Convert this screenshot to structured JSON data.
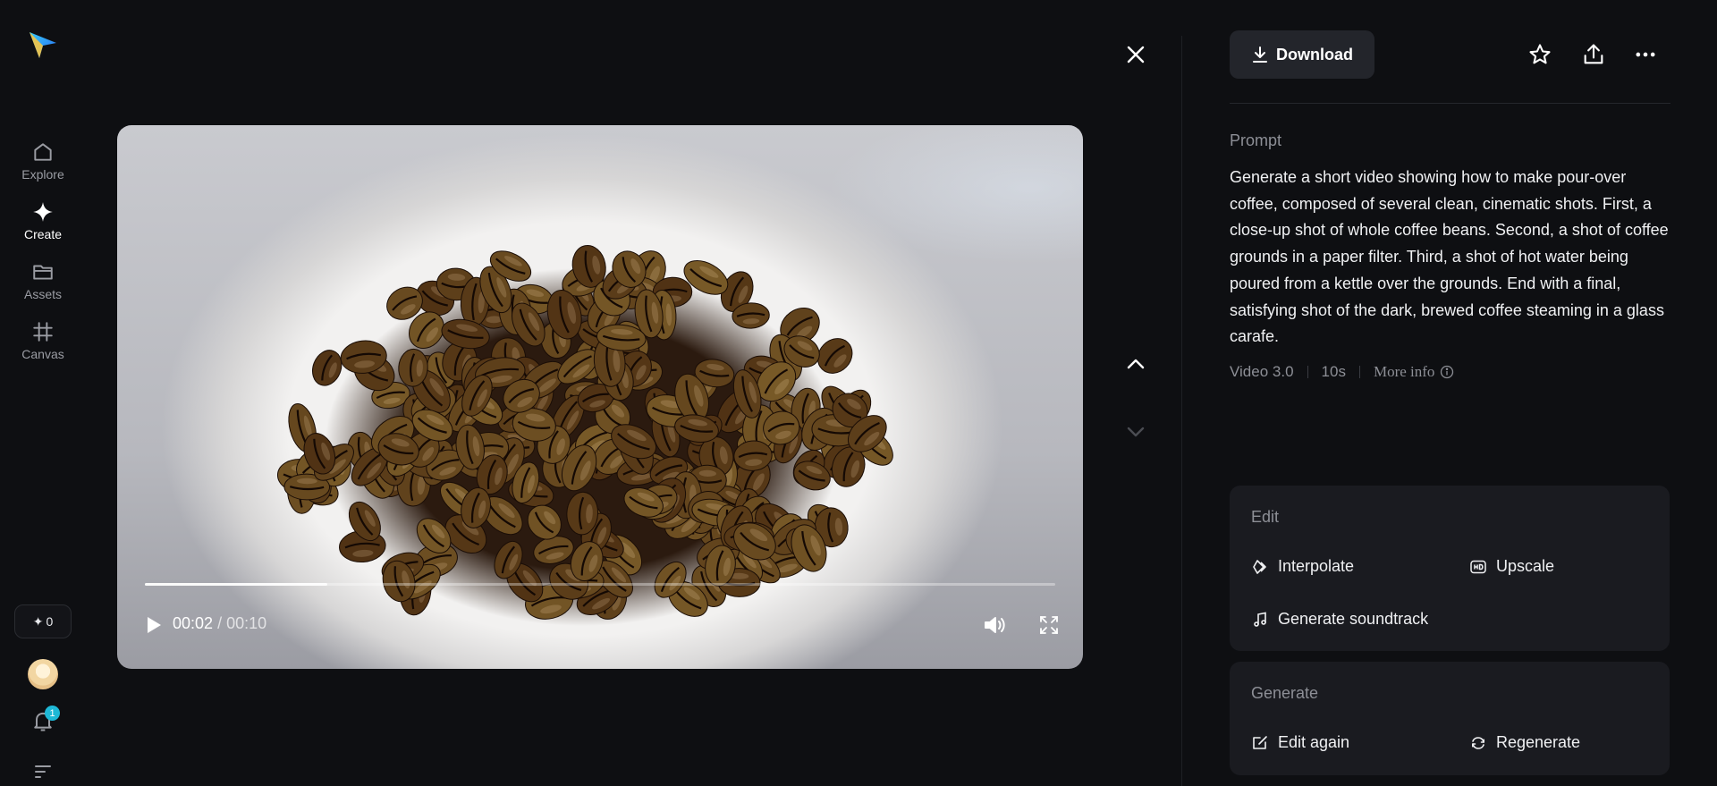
{
  "sidebar": {
    "items": [
      {
        "label": "Explore",
        "icon": "home-icon"
      },
      {
        "label": "Create",
        "icon": "sparkle-icon"
      },
      {
        "label": "Assets",
        "icon": "folder-icon"
      },
      {
        "label": "Canvas",
        "icon": "canvas-icon"
      }
    ],
    "credits": "0",
    "notification_count": "1"
  },
  "player": {
    "current_time": "00:02",
    "separator": "/",
    "total_time": "00:10",
    "progress": 0.2
  },
  "panel": {
    "download_label": "Download",
    "prompt_title": "Prompt",
    "prompt_text": "Generate a short video showing how to make pour-over coffee, composed of several clean, cinematic shots. First, a close-up shot of whole coffee beans. Second, a shot of coffee grounds in a paper filter. Third, a shot of hot water being poured from a kettle over the grounds. End with a final, satisfying shot of the dark, brewed coffee steaming in a glass carafe.",
    "model": "Video 3.0",
    "duration": "10s",
    "more_info": "More info"
  },
  "edit": {
    "title": "Edit",
    "interpolate": "Interpolate",
    "upscale": "Upscale",
    "soundtrack": "Generate soundtrack"
  },
  "generate": {
    "title": "Generate",
    "edit_again": "Edit again",
    "regenerate": "Regenerate"
  },
  "colors": {
    "background": "#0e0f12",
    "card": "#1a1b20",
    "accent_badge": "#1eb8d6"
  }
}
